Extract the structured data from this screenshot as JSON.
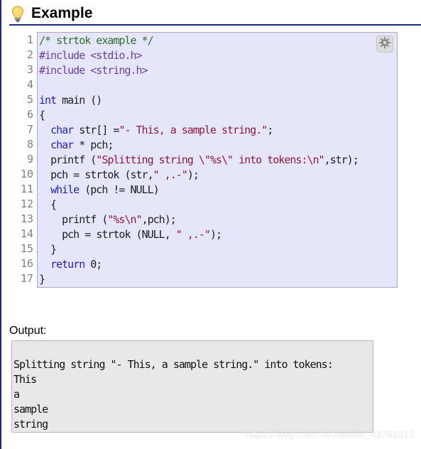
{
  "heading": {
    "title": "Example",
    "icon": "lightbulb-icon"
  },
  "code": {
    "lines": [
      "/* strtok example */",
      "#include <stdio.h>",
      "#include <string.h>",
      "",
      "int main ()",
      "{",
      "  char str[] =\"- This, a sample string.\";",
      "  char * pch;",
      "  printf (\"Splitting string \\\"%s\\\" into tokens:\\n\",str);",
      "  pch = strtok (str,\" ,.-\");",
      "  while (pch != NULL)",
      "  {",
      "    printf (\"%s\\n\",pch);",
      "    pch = strtok (NULL, \" ,.-\");",
      "  }",
      "  return 0;",
      "}"
    ],
    "line_numbers": [
      "1",
      "2",
      "3",
      "4",
      "5",
      "6",
      "7",
      "8",
      "9",
      "10",
      "11",
      "12",
      "13",
      "14",
      "15",
      "16",
      "17"
    ],
    "settings_icon": "gear-icon"
  },
  "output": {
    "label": "Output:",
    "lines": [
      "",
      "Splitting string \"- This, a sample string.\" into tokens:",
      "This",
      "a",
      "sample",
      "string"
    ]
  },
  "watermark": "https://blog.csdn.net/weixin_43701312",
  "colors": {
    "heading_rule": "#1c2a7a",
    "code_background": "#e6e6fa",
    "output_background": "#e8e8e8",
    "keyword": "#1f1fb0",
    "string": "#8b1a3c",
    "comment": "#2f6f2f",
    "preprocessor": "#6b3fa0"
  }
}
